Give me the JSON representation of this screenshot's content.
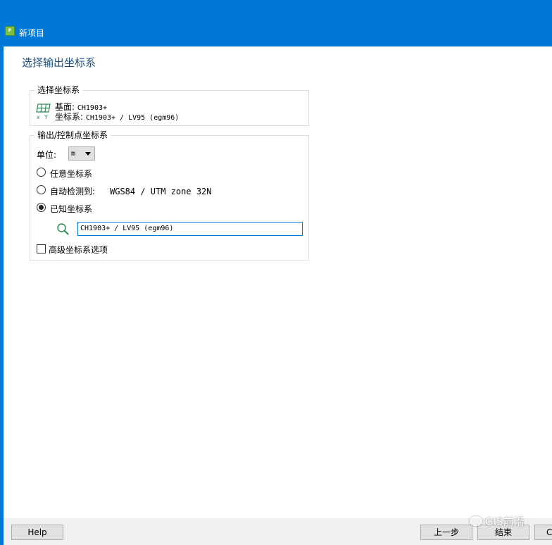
{
  "window": {
    "title": "新项目",
    "app_icon_text": "Pix4D"
  },
  "page": {
    "heading": "选择输出坐标系"
  },
  "selected_crs_group": {
    "legend": "选择坐标系",
    "datum_label": "基面:",
    "datum_value": "CH1903+",
    "crs_label": "坐标系:",
    "crs_value": "CH1903+ / LV95 (egm96)",
    "icon": "grid-xy-icon"
  },
  "output_group": {
    "legend": "输出/控制点坐标系",
    "unit_label": "单位:",
    "unit_value": "m",
    "options": [
      {
        "label": "任意坐标系",
        "detail": "",
        "checked": false
      },
      {
        "label": "自动检测到:",
        "detail": "WGS84 / UTM zone 32N",
        "checked": false
      },
      {
        "label": "已知坐标系",
        "detail": "",
        "checked": true
      }
    ],
    "known_crs_value": "CH1903+ / LV95 (egm96)",
    "advanced_label": "高级坐标系选项",
    "advanced_checked": false
  },
  "footer": {
    "help": "Help",
    "back": "上一步",
    "finish": "结束",
    "cancel": "C"
  },
  "watermark": {
    "text": "GIS前沿"
  },
  "colors": {
    "titlebar": "#0078d7",
    "heading": "#1f4e79",
    "icon_green": "#2e8b57"
  }
}
